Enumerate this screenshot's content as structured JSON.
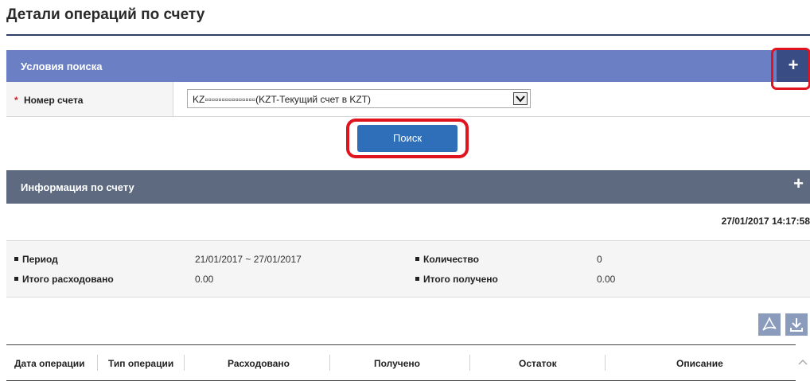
{
  "page": {
    "title": "Детали операций по счету"
  },
  "search": {
    "title": "Условия поиска",
    "expand_label": "+",
    "required_mark": "*",
    "account_label": "Номер счета",
    "account_value": "KZ▫▫▫▫▫▫▫▫▫▫▫▫▫▫▫(KZT-Текущий счет в KZT)",
    "button_label": "Поиск"
  },
  "account_info": {
    "title": "Информация по счету",
    "expand_label": "+",
    "timestamp": "27/01/2017 14:17:58",
    "period_label": "Период",
    "period_value": "21/01/2017 ~ 27/01/2017",
    "count_label": "Количество",
    "count_value": "0",
    "spent_label": "Итого расходовано",
    "spent_value": "0.00",
    "received_label": "Итого получено",
    "received_value": "0.00"
  },
  "toolbar": {
    "pdf_icon": "pdf-icon",
    "download_icon": "download-icon"
  },
  "table": {
    "columns": [
      "Дата операции",
      "Тип операции",
      "Расходовано",
      "Получено",
      "Остаток",
      "Описание"
    ]
  },
  "colors": {
    "search_bar": "#6b80c4",
    "info_bar": "#5e6a80",
    "primary_button": "#2f6fb9",
    "highlight": "#e0141f"
  }
}
